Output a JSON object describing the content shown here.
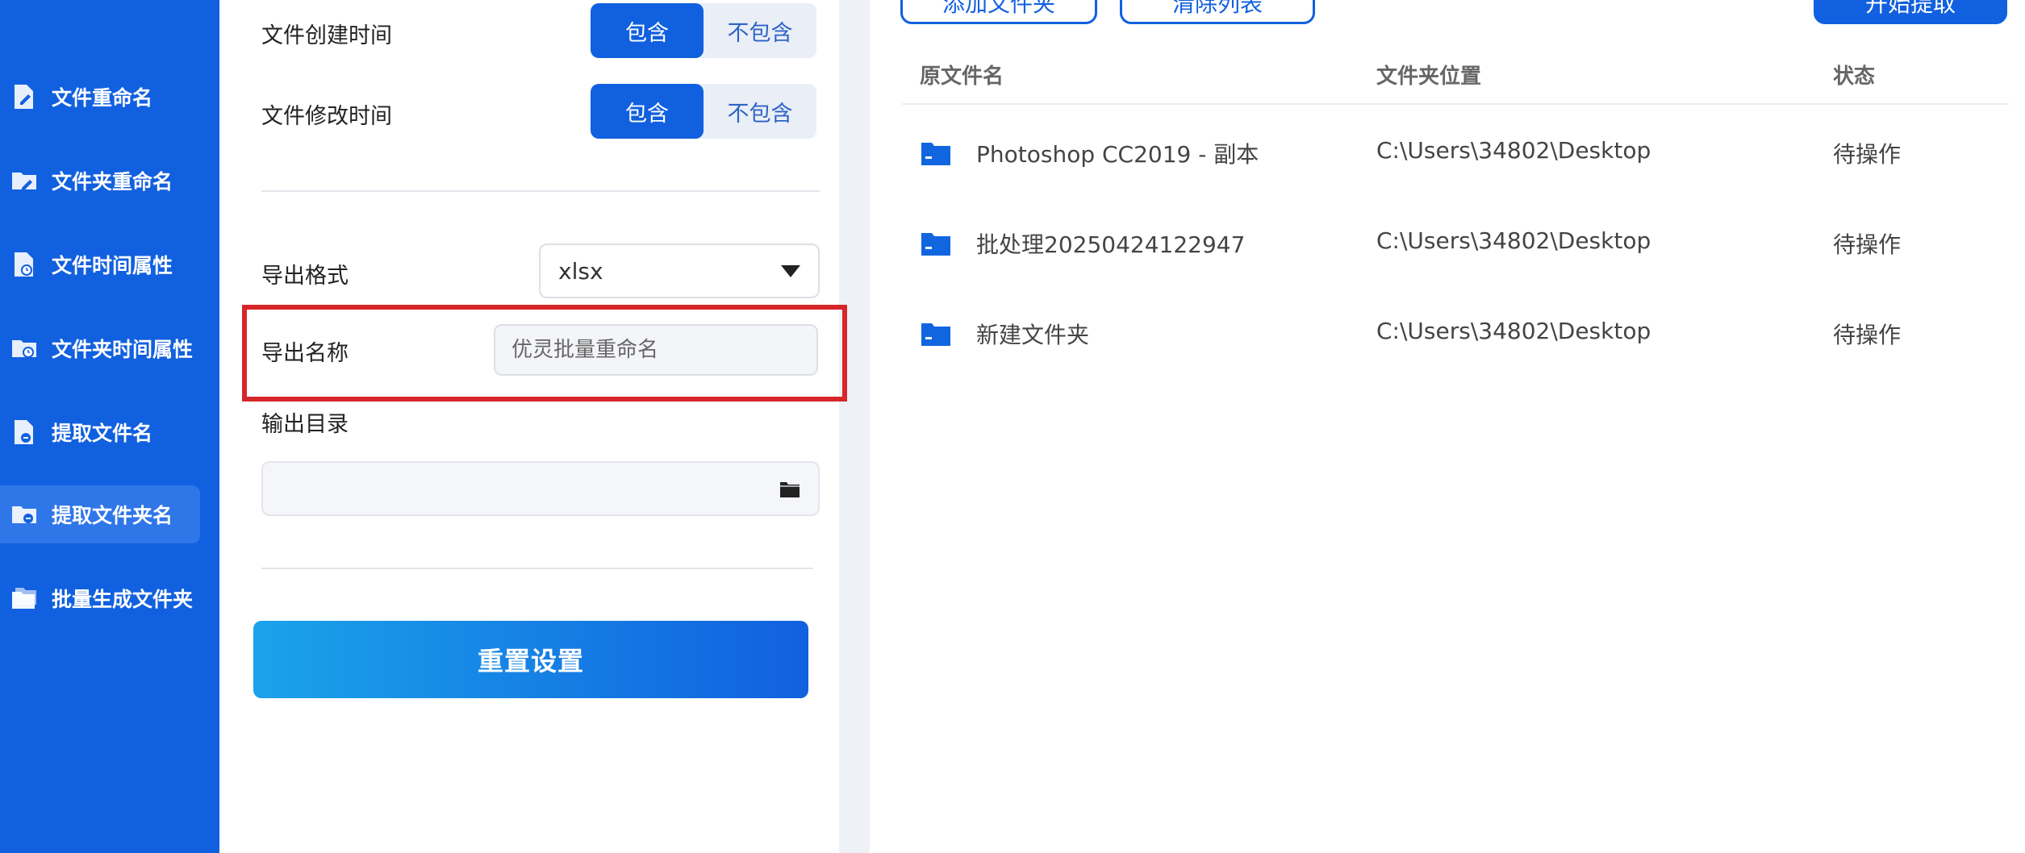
{
  "sidebar": {
    "items": [
      {
        "label": "文件重命名",
        "icon": "file-rename-icon"
      },
      {
        "label": "文件夹重命名",
        "icon": "folder-rename-icon"
      },
      {
        "label": "文件时间属性",
        "icon": "file-time-icon"
      },
      {
        "label": "文件夹时间属性",
        "icon": "folder-time-icon"
      },
      {
        "label": "提取文件名",
        "icon": "extract-filename-icon"
      },
      {
        "label": "提取文件夹名",
        "icon": "extract-foldername-icon",
        "active": true
      },
      {
        "label": "批量生成文件夹",
        "icon": "batch-folder-icon"
      }
    ]
  },
  "settings": {
    "created_time": {
      "label": "文件创建时间",
      "include": "包含",
      "exclude": "不包含",
      "selected": "包含"
    },
    "modified_time": {
      "label": "文件修改时间",
      "include": "包含",
      "exclude": "不包含",
      "selected": "包含"
    },
    "export_format": {
      "label": "导出格式",
      "value": "xlsx"
    },
    "export_name": {
      "label": "导出名称",
      "placeholder": "优灵批量重命名",
      "value": ""
    },
    "output_dir": {
      "label": "输出目录",
      "value": ""
    },
    "reset_label": "重置设置"
  },
  "toolbar": {
    "add_folder": "添加文件夹",
    "clear_list": "清除列表",
    "start": "开始提取"
  },
  "table": {
    "headers": {
      "name": "原文件名",
      "location": "文件夹位置",
      "status": "状态"
    },
    "rows": [
      {
        "name": "Photoshop CC2019 - 副本",
        "location": "C:\\Users\\34802\\Desktop",
        "status": "待操作"
      },
      {
        "name": "批处理20250424122947",
        "location": "C:\\Users\\34802\\Desktop",
        "status": "待操作"
      },
      {
        "name": "新建文件夹",
        "location": "C:\\Users\\34802\\Desktop",
        "status": "待操作"
      }
    ]
  },
  "colors": {
    "brand": "#1160df",
    "highlight": "#d7262a"
  }
}
